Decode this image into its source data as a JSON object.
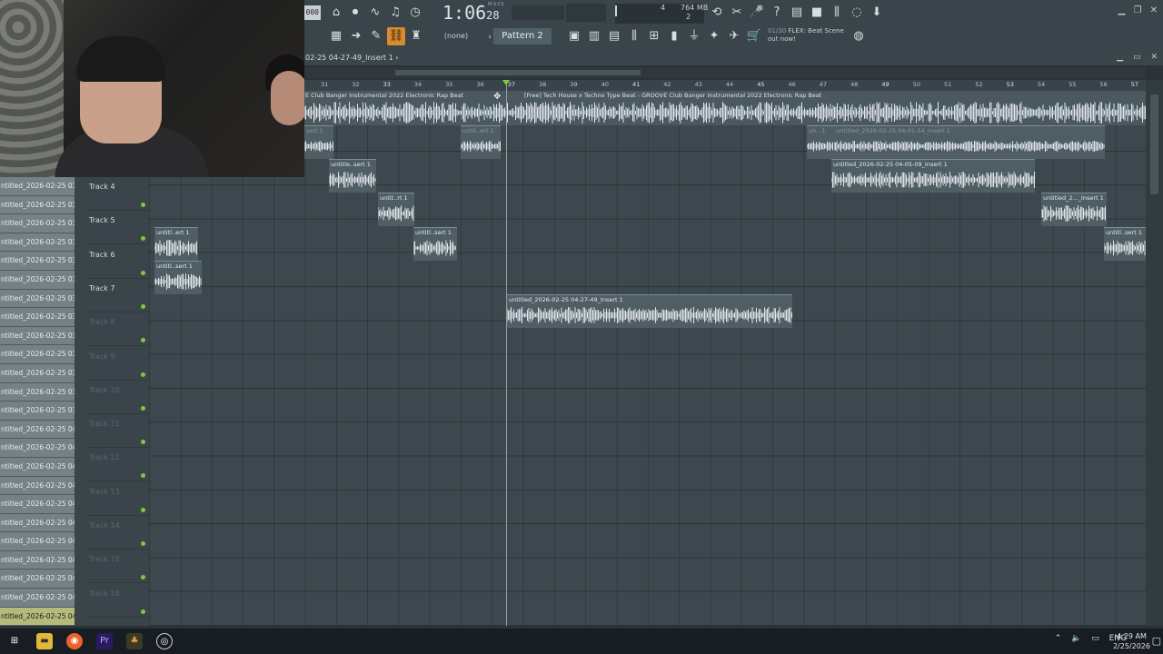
{
  "toolbar": {
    "bpm_partial": "000",
    "time_main": "1:06",
    "time_sub": "28",
    "time_label": "M:S:CS",
    "cpu": "4",
    "memory": "764 MB",
    "poly": "2",
    "none_label": "(none)",
    "pattern": "Pattern 2",
    "hint_num": "01/30",
    "hint_text": "FLEX: Beat Scene out now!",
    "icons": [
      "metronome-icon",
      "record-mode-icon",
      "wait-icon",
      "step-edit-icon",
      "countdown-icon",
      "piano-icon",
      "arrow-icon",
      "paint-icon",
      "link-icon",
      "stamp-icon"
    ]
  },
  "playlist": {
    "title": "02-25 04-27-49_Insert 1",
    "title_arrow": "›",
    "ruler": [
      "31",
      "32",
      "33",
      "34",
      "35",
      "36",
      "37",
      "38",
      "39",
      "40",
      "41",
      "42",
      "43",
      "44",
      "45",
      "46",
      "47",
      "48",
      "49",
      "50",
      "51",
      "52",
      "53",
      "54",
      "55",
      "56",
      "57"
    ],
    "master_labels": [
      "E  Club Banger Instrumental 2022  Electronic Rap Beat",
      "[Free] Tech House x Techno Type Beat - GROOVE  Club Banger Instrumental 2022  Electronic Rap Beat"
    ]
  },
  "browser": {
    "items": [
      "ntitled_2026-02-25 03-...",
      "ntitled_2026-02-25 03-...",
      "ntitled_2026-02-25 03-...",
      "ntitled_2026-02-25 03-...",
      "ntitled_2026-02-25 03-...",
      "ntitled_2026-02-25 03-...",
      "ntitled_2026-02-25 03-...",
      "ntitled_2026-02-25 03-...",
      "ntitled_2026-02-25 03-...",
      "ntitled_2026-02-25 03-...",
      "ntitled_2026-02-25 03-...",
      "ntitled_2026-02-25 03-...",
      "ntitled_2026-02-25 03-...",
      "ntitled_2026-02-25 04-...",
      "ntitled_2026-02-25 04-...",
      "ntitled_2026-02-25 04-...",
      "ntitled_2026-02-25 04-...",
      "ntitled_2026-02-25 04-...",
      "ntitled_2026-02-25 04-...",
      "ntitled_2026-02-25 04-...",
      "ntitled_2026-02-25 04-...",
      "ntitled_2026-02-25 04-...",
      "ntitled_2026-02-25 04-...",
      "ntitled_2026-02-25 04-..."
    ]
  },
  "tracks": [
    {
      "name": "Track 4"
    },
    {
      "name": "Track 5"
    },
    {
      "name": "Track 6"
    },
    {
      "name": "Track 7"
    },
    {
      "name": "Track 8"
    },
    {
      "name": "Track 9"
    },
    {
      "name": "Track 10"
    },
    {
      "name": "Track 11"
    },
    {
      "name": "Track 12"
    },
    {
      "name": "Track 13"
    },
    {
      "name": "Track 14"
    },
    {
      "name": "Track 15"
    },
    {
      "name": "Track 16"
    }
  ],
  "clips": [
    {
      "label": "sert 1"
    },
    {
      "label": "untit..ert 1"
    },
    {
      "label": "un...1"
    },
    {
      "label": "untitled_2026-02-25 04-01-54_Insert 1"
    },
    {
      "label": "untitle..sert 1"
    },
    {
      "label": "untitled_2026-02-25 04-05-09_Insert 1"
    },
    {
      "label": "untit..rt 1"
    },
    {
      "label": "untitled_2..._Insert 1"
    },
    {
      "label": "untitl..ert 1"
    },
    {
      "label": "untitl..sert 1"
    },
    {
      "label": "untitl..sert 1"
    },
    {
      "label": "untitl..sert 1"
    },
    {
      "label": "untitled_2026-02-25 04-27-49_Insert 1"
    }
  ],
  "taskbar": {
    "lang": "ENG",
    "time": "4:29 AM",
    "date": "2/25/2026",
    "apps": [
      "windows-start-icon",
      "file-explorer-icon",
      "firefox-icon",
      "premiere-pro-icon",
      "fl-studio-icon",
      "obs-icon"
    ]
  }
}
